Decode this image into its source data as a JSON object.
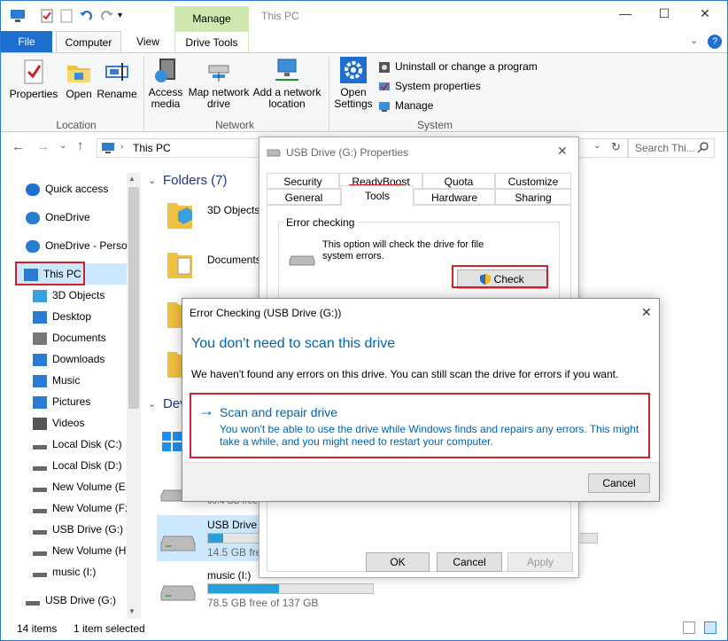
{
  "window": {
    "title": "This PC",
    "manage_tab": "Manage",
    "tabs": {
      "file": "File",
      "computer": "Computer",
      "view": "View",
      "drive_tools": "Drive Tools"
    },
    "controls": {
      "minimize": "—",
      "maximize": "☐",
      "close": "✕"
    }
  },
  "ribbon": {
    "properties": "Properties",
    "open": "Open",
    "rename": "Rename",
    "location_group": "Location",
    "access_media": "Access media",
    "map_network": "Map network drive",
    "add_network": "Add a network location",
    "network_group": "Network",
    "open_settings": "Open Settings",
    "uninstall": "Uninstall or change a program",
    "system_properties": "System properties",
    "manage": "Manage",
    "system_group": "System"
  },
  "address": {
    "path": "This PC",
    "search_placeholder": "Search Thi..."
  },
  "nav": {
    "items": [
      {
        "label": "Quick access",
        "icon": "star-icon",
        "color": "#1e6fcf"
      },
      {
        "label": "OneDrive",
        "icon": "cloud-icon",
        "color": "#2b7bd0"
      },
      {
        "label": "OneDrive - Perso",
        "icon": "cloud-icon",
        "color": "#2b7bd0"
      },
      {
        "label": "This PC",
        "icon": "monitor-icon",
        "color": "#2b7bd0"
      },
      {
        "label": "3D Objects",
        "icon": "cube-icon",
        "color": "#3aa0e0"
      },
      {
        "label": "Desktop",
        "icon": "desktop-icon",
        "color": "#2b7bd0"
      },
      {
        "label": "Documents",
        "icon": "document-icon",
        "color": "#777"
      },
      {
        "label": "Downloads",
        "icon": "download-icon",
        "color": "#2b7bd0"
      },
      {
        "label": "Music",
        "icon": "music-icon",
        "color": "#2b7bd0"
      },
      {
        "label": "Pictures",
        "icon": "pictures-icon",
        "color": "#2b7bd0"
      },
      {
        "label": "Videos",
        "icon": "videos-icon",
        "color": "#555"
      },
      {
        "label": "Local Disk (C:)",
        "icon": "drive-icon",
        "color": "#666"
      },
      {
        "label": "Local Disk (D:)",
        "icon": "drive-icon",
        "color": "#666"
      },
      {
        "label": "New Volume (E:)",
        "icon": "drive-icon",
        "color": "#666"
      },
      {
        "label": "New Volume (F:)",
        "icon": "drive-icon",
        "color": "#666"
      },
      {
        "label": "USB Drive (G:)",
        "icon": "drive-icon",
        "color": "#666"
      },
      {
        "label": "New Volume (H:)",
        "icon": "drive-icon",
        "color": "#666"
      },
      {
        "label": "music (I:)",
        "icon": "drive-icon",
        "color": "#666"
      },
      {
        "label": "USB Drive (G:)",
        "icon": "drive-icon",
        "color": "#666"
      }
    ]
  },
  "content": {
    "folders_header": "Folders (7)",
    "devices_header": "Dev",
    "folder_1": "3D Objects",
    "folder_2": "Documents",
    "drive_g_free_partial": "69.4 GB free",
    "drive_g_name": "USB Drive (G",
    "drive_g_free": "14.5 GB free",
    "drive_g_fill": 0.3,
    "drive_i_name": "music (I:)",
    "drive_i_free": "78.5 GB free of 137 GB",
    "drive_i_fill": 0.43
  },
  "status": {
    "items": "14 items",
    "selected": "1 item selected"
  },
  "props": {
    "title": "USB Drive (G:) Properties",
    "tabs_row1": [
      "Security",
      "ReadyBoost",
      "Quota",
      "Customize"
    ],
    "tabs_row2": [
      "General",
      "Tools",
      "Hardware",
      "Sharing"
    ],
    "error_checking": "Error checking",
    "description": "This option will check the drive for file system errors.",
    "check": "Check",
    "ok": "OK",
    "cancel": "Cancel",
    "apply": "Apply"
  },
  "err": {
    "title": "Error Checking (USB Drive (G:))",
    "heading": "You don't need to scan this drive",
    "message": "We haven't found any errors on this drive. You can still scan the drive for errors if you want.",
    "option_title": "Scan and repair drive",
    "option_desc": "You won't be able to use the drive while Windows finds and repairs any errors. This might take a while, and you might need to restart your computer.",
    "cancel": "Cancel",
    "close": "✕"
  },
  "colors": {
    "accent": "#1e6fcf",
    "link": "#0063b1",
    "highlight": "#d0202a"
  }
}
